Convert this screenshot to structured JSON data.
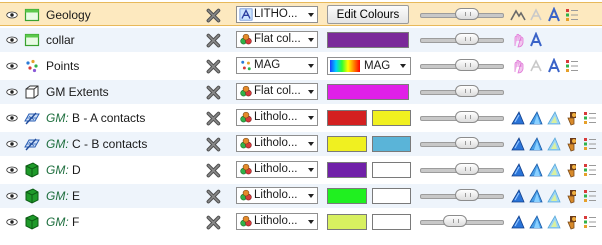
{
  "colors": {
    "selected_row_bg": "#fde9bf",
    "alt_row_bg": "#eef4fb",
    "gm_text": "#1f6f3f"
  },
  "rows": [
    {
      "label": "Geology",
      "prefix": "",
      "icon": "surface-icon",
      "combo_icon": "gradient-letter-icon",
      "combo_text": "LITHO...",
      "control": "button",
      "button_label": "Edit Colours",
      "slider_pct": 0.6,
      "tools": [
        "shading-icon",
        "light-icon",
        "font-icon",
        "legend-icon"
      ]
    },
    {
      "label": "collar",
      "prefix": "",
      "icon": "surface-icon",
      "combo_icon": "palette-icon",
      "combo_text": "Flat col...",
      "control": "swatch",
      "swatch": "#7a2a9a",
      "slider_pct": 0.6,
      "tools": [
        "hand-icon",
        "font-icon"
      ]
    },
    {
      "label": "Points",
      "prefix": "",
      "icon": "points-icon",
      "combo_icon": "points-colour-icon",
      "combo_text": "MAG",
      "control": "ramp",
      "ramp_text": "MAG",
      "slider_pct": 0.6,
      "tools": [
        "hand-icon",
        "light-icon",
        "font-icon",
        "legend-icon"
      ]
    },
    {
      "label": "GM Extents",
      "prefix": "",
      "icon": "extents-icon",
      "combo_icon": "palette-icon",
      "combo_text": "Flat col...",
      "control": "swatch",
      "swatch": "#e020e8",
      "slider_pct": 0.6,
      "tools": []
    },
    {
      "label": " B - A contacts",
      "prefix": "GM:",
      "icon": "contact-surface-icon",
      "combo_icon": "palette-icon",
      "combo_text": "Litholo...",
      "control": "two-swatch",
      "swatch": "#d42020",
      "swatch2": "#f0f020",
      "slider_pct": 0.6,
      "tools": [
        "blue-arrow-icon",
        "multi-arrow-icon",
        "light-arrow-icon",
        "paint-icon",
        "legend-icon"
      ]
    },
    {
      "label": " C - B contacts",
      "prefix": "GM:",
      "icon": "contact-surface-icon",
      "combo_icon": "palette-icon",
      "combo_text": "Litholo...",
      "control": "two-swatch",
      "swatch": "#f0f020",
      "swatch2": "#5ab4d8",
      "slider_pct": 0.6,
      "tools": [
        "blue-arrow-icon",
        "multi-arrow-icon",
        "light-arrow-icon",
        "paint-icon",
        "legend-icon"
      ]
    },
    {
      "label": " D",
      "prefix": "GM:",
      "icon": "volume-icon",
      "combo_icon": "palette-icon",
      "combo_text": "Litholo...",
      "control": "two-swatch",
      "swatch": "#7020a8",
      "swatch2": "#ffffff",
      "slider_pct": 0.6,
      "tools": [
        "blue-arrow-icon",
        "multi-arrow-icon",
        "light-arrow-icon",
        "paint-icon",
        "legend-icon"
      ]
    },
    {
      "label": " E",
      "prefix": "GM:",
      "icon": "volume-icon",
      "combo_icon": "palette-icon",
      "combo_text": "Litholo...",
      "control": "two-swatch",
      "swatch": "#20f020",
      "swatch2": "#ffffff",
      "slider_pct": 0.6,
      "tools": [
        "blue-arrow-icon",
        "multi-arrow-icon",
        "light-arrow-icon",
        "paint-icon",
        "legend-icon"
      ]
    },
    {
      "label": " F",
      "prefix": "GM:",
      "icon": "volume-icon",
      "combo_icon": "palette-icon",
      "combo_text": "Litholo...",
      "control": "two-swatch",
      "swatch": "#d8f060",
      "swatch2": "#ffffff",
      "slider_pct": 0.4,
      "tools": [
        "blue-arrow-icon",
        "multi-arrow-icon",
        "light-arrow-icon",
        "paint-icon",
        "legend-icon"
      ]
    }
  ]
}
